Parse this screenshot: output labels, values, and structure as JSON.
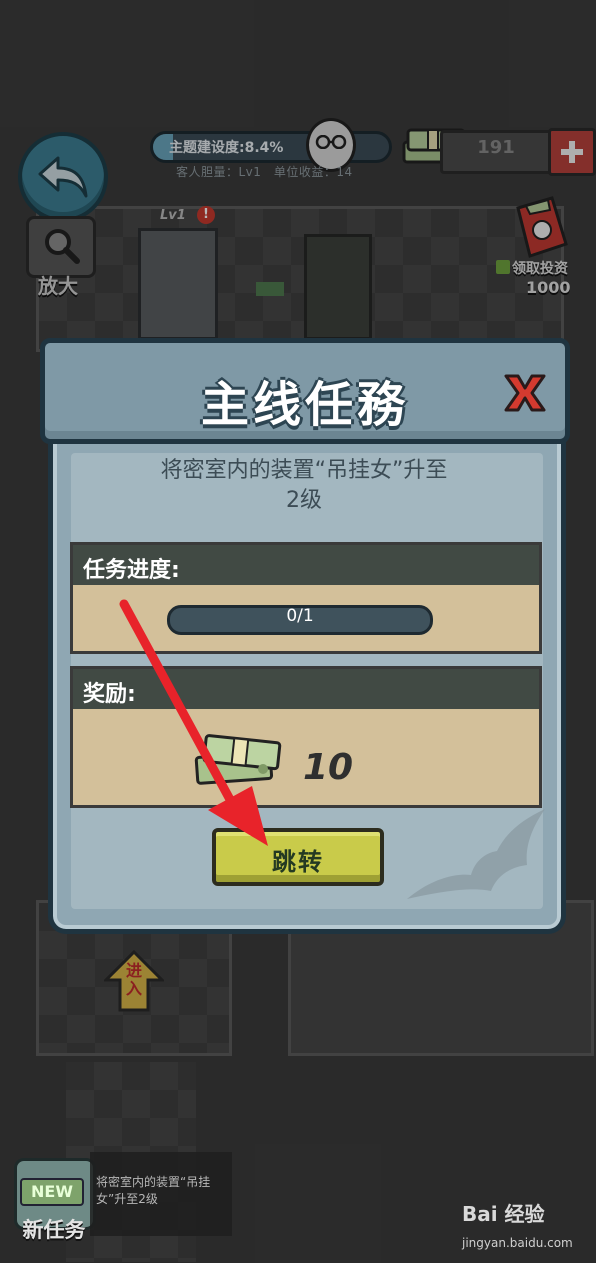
{
  "hud": {
    "theme_text": "主题建设度:8.4%",
    "theme_progress": 0.084,
    "sub_stats": "客人胆量：Lv1　单位收益：14",
    "money_count": "191",
    "zoom_label": "放大",
    "level_badge": "Lv1",
    "invest_label": "领取投资",
    "invest_amount": "1000"
  },
  "modal": {
    "title": "主线任務",
    "description_line1": "将密室内的装置“吊挂女”升至",
    "description_line2": "2级",
    "progress_label": "任务进度:",
    "progress_text": "0/1",
    "progress_value": 0,
    "reward_label": "奖励:",
    "reward_amount": "10",
    "jump_button": "跳转"
  },
  "bottom": {
    "new_badge": "NEW",
    "new_task_label": "新任务",
    "new_task_text": "将密室内的装置“吊挂女”升至2级",
    "enter_label": "进入"
  },
  "watermark": {
    "main": "Bai 经验",
    "sub": "jingyan.baidu.com"
  },
  "colors": {
    "modal_frame": "#1f3440",
    "modal_header": "#7f99a6",
    "section_header": "#414a44",
    "section_body": "#d3c09a",
    "jump_button": "#c9cb4a",
    "annotation_arrow": "#e8232a"
  }
}
